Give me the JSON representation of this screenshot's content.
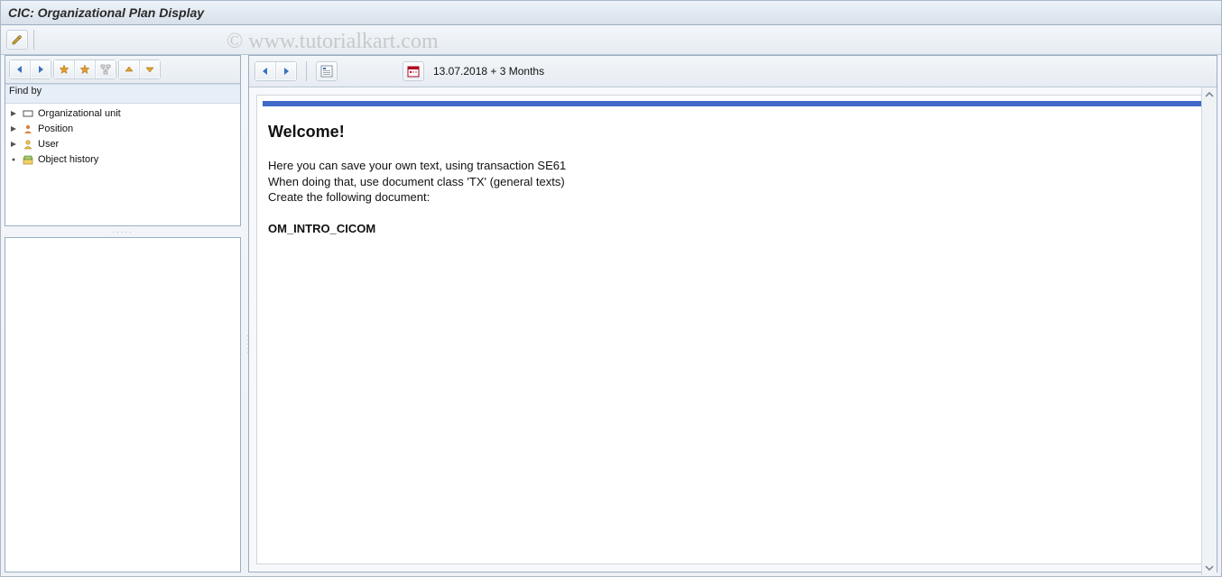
{
  "title": "CIC: Organizational Plan Display",
  "watermark": "© www.tutorialkart.com",
  "main_toolbar": {
    "pencil_icon": "edit-icon"
  },
  "left": {
    "find_by_label": "Find by",
    "tree": [
      {
        "label": "Organizational unit",
        "icon": "org-unit-icon"
      },
      {
        "label": "Position",
        "icon": "position-icon"
      },
      {
        "label": "User",
        "icon": "user-icon"
      },
      {
        "label": "Object history",
        "icon": "history-icon"
      }
    ]
  },
  "right": {
    "date_text": "13.07.2018  + 3 Months",
    "welcome_heading": "Welcome!",
    "line1": "Here you can save your own text, using transaction SE61",
    "line2": "When doing that, use document class 'TX' (general texts)",
    "line3": "Create the following document:",
    "doc_name": "OM_INTRO_CICOM"
  }
}
